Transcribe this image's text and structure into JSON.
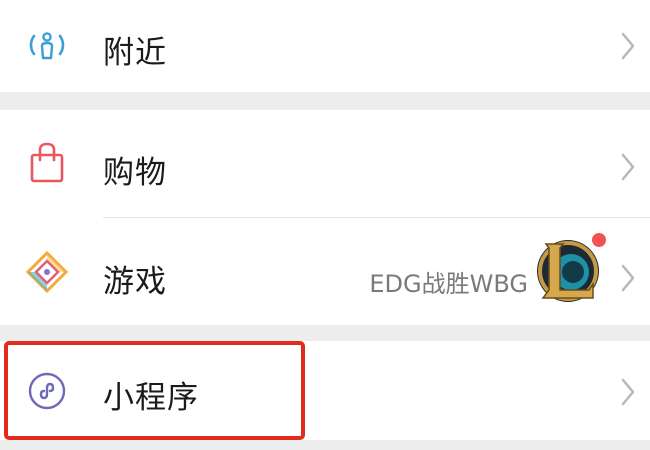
{
  "items": {
    "nearby": {
      "label": "附近",
      "icon": "nearby-person-icon"
    },
    "shopping": {
      "label": "购物",
      "icon": "shopping-bag-icon"
    },
    "games": {
      "label": "游戏",
      "icon": "game-diamond-icon",
      "extra_text": "EDG战胜WBG",
      "has_badge": true
    },
    "mini_programs": {
      "label": "小程序",
      "icon": "mini-program-icon",
      "highlighted": true
    }
  },
  "colors": {
    "nearby_icon": "#3a9fd6",
    "shopping_icon": "#e8585e",
    "mini_program_icon": "#6f6ab5",
    "badge": "#f15353",
    "highlight_border": "#e32a1d",
    "background": "#ededed"
  }
}
